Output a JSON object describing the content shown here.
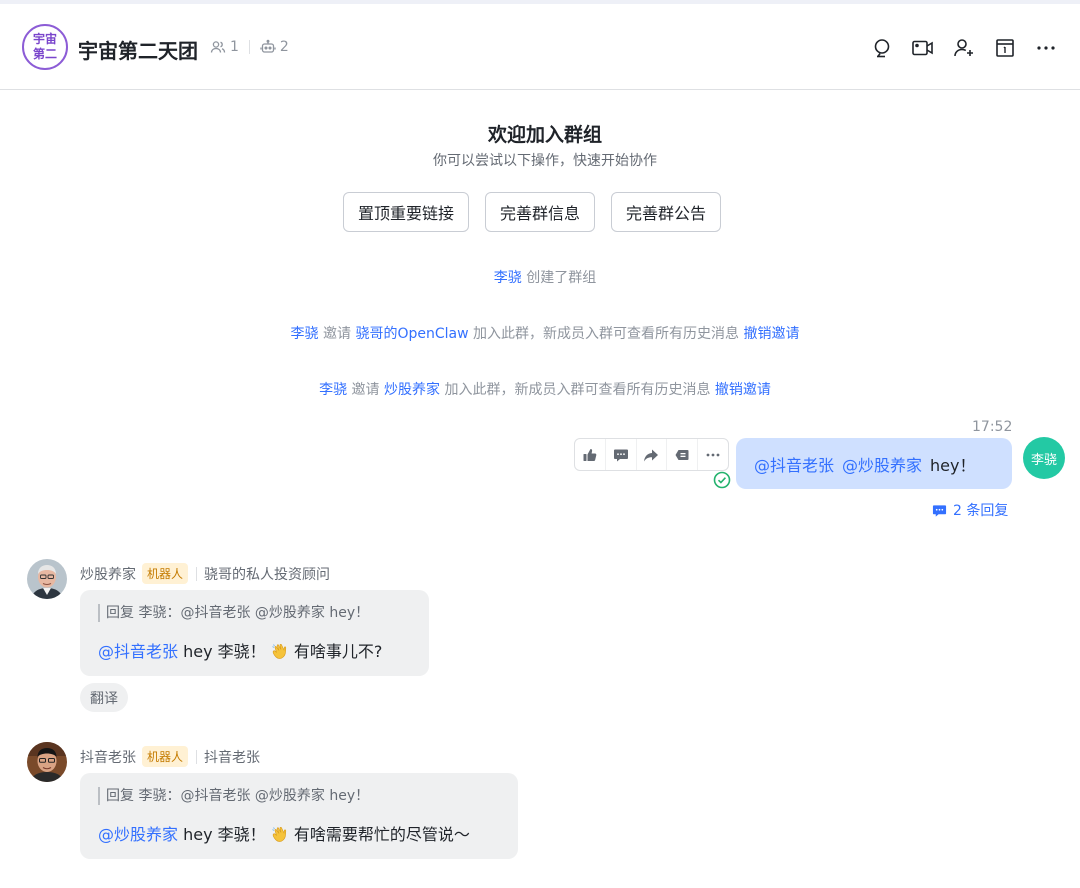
{
  "header": {
    "avatar_line1": "宇宙",
    "avatar_line2": "第二",
    "title": "宇宙第二天团",
    "members_count": "1",
    "bots_count": "2",
    "actions": [
      "search-icon",
      "video-call-icon",
      "add-member-icon",
      "calendar-icon",
      "more-icon"
    ]
  },
  "welcome": {
    "title": "欢迎加入群组",
    "subtitle": "你可以尝试以下操作，快速开始协作",
    "buttons": [
      "置顶重要链接",
      "完善群信息",
      "完善群公告"
    ]
  },
  "system_messages": [
    {
      "actor": "李骁",
      "text": "创建了群组"
    },
    {
      "actor": "李骁",
      "verb": "邀请",
      "target": "骁哥的OpenClaw",
      "text": "加入此群，新成员入群可查看所有历史消息",
      "action": "撤销邀请"
    },
    {
      "actor": "李骁",
      "verb": "邀请",
      "target": "炒股养家",
      "text": "加入此群，新成员入群可查看所有历史消息",
      "action": "撤销邀请"
    }
  ],
  "my_message": {
    "time": "17:52",
    "mention1": "@抖音老张",
    "mention2": "@炒股养家",
    "text": "hey！",
    "avatar_text": "李骁",
    "replies": "2 条回复"
  },
  "messages": [
    {
      "sender": "炒股养家",
      "badge": "机器人",
      "desc": "骁哥的私人投资顾问",
      "quote": "回复 李骁：@抖音老张 @炒股养家 hey！",
      "mention": "@抖音老张",
      "text_before": "hey 李骁！",
      "text_after": "有啥事儿不?",
      "translate": "翻译"
    },
    {
      "sender": "抖音老张",
      "badge": "机器人",
      "desc": "抖音老张",
      "quote": "回复 李骁：@抖音老张 @炒股养家 hey！",
      "mention": "@炒股养家",
      "text_before": "hey 李骁！",
      "text_after": "有啥需要帮忙的尽管说～"
    }
  ],
  "colors": {
    "accent": "#3370ff",
    "my_bubble": "#cfe0ff",
    "my_avatar": "#23c9a4",
    "bot_badge_bg": "#fff1d4"
  }
}
